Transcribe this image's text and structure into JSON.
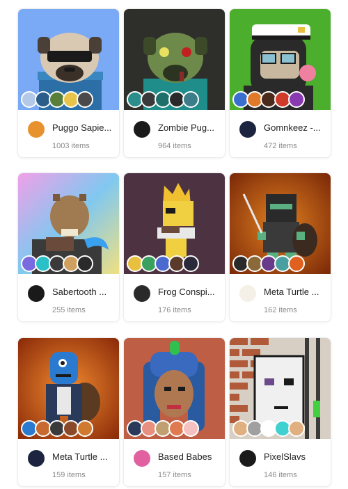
{
  "collections": [
    {
      "name": "Puggo Sapie...",
      "items": "1003 items",
      "bg": "#7aa9f5",
      "logo": "#e8922f",
      "avatars": [
        "#b4c8e8",
        "#2a5d8a",
        "#5a7f3a",
        "#e8c54a",
        "#4a4a4a"
      ]
    },
    {
      "name": "Zombie Pug...",
      "items": "964 items",
      "bg": "#2e2e2a",
      "logo": "#1a1a1a",
      "avatars": [
        "#2b8e8a",
        "#3a3a3a",
        "#1e6f6a",
        "#2a2a2a",
        "#3b7e8a"
      ]
    },
    {
      "name": "Gomnkeez -...",
      "items": "472 items",
      "bg": "#56b833",
      "logo": "#1c2440",
      "avatars": [
        "#3a6fd0",
        "#e07a2a",
        "#4a2a1a",
        "#d03a2a",
        "#8a3ab0"
      ]
    },
    {
      "name": "Sabertooth ...",
      "items": "255 items",
      "bg": "#b8a4e8",
      "logo": "#1a1a1a",
      "avatars": [
        "#7a6ae0",
        "#2ac0c8",
        "#3a3a3a",
        "#d0a060",
        "#2a2a2a"
      ]
    },
    {
      "name": "Frog Conspi...",
      "items": "176 items",
      "bg": "#5a3a4a",
      "logo": "#2a2a2a",
      "avatars": [
        "#e8c040",
        "#3aa060",
        "#4a6ad0",
        "#5a3a2a",
        "#2a2a3a"
      ]
    },
    {
      "name": "Meta Turtle ...",
      "items": "162 items",
      "bg": "#a04010",
      "logo": "#f4f0e8",
      "avatars": [
        "#2a2a2a",
        "#8a6a3a",
        "#6a3a8a",
        "#4aa0a0",
        "#e06020"
      ]
    },
    {
      "name": "Meta Turtle ...",
      "items": "159 items",
      "bg": "#b85820",
      "logo": "#1c2440",
      "avatars": [
        "#2a7ad0",
        "#c86a30",
        "#3a3a3a",
        "#8a4a2a",
        "#d07a30"
      ]
    },
    {
      "name": "Based Babes",
      "items": "157 items",
      "bg": "#e07a50",
      "logo": "#e060a0",
      "avatars": [
        "#2a3a5a",
        "#e89080",
        "#c0a070",
        "#e07a50",
        "#f4c0c0"
      ]
    },
    {
      "name": "PixelSlavs",
      "items": "146 items",
      "bg": "#d8cfc4",
      "logo": "#1a1a1a",
      "avatars": [
        "#e0b080",
        "#a0a0a0",
        "#ffffff",
        "#40d0d0",
        "#e0b080"
      ]
    }
  ]
}
